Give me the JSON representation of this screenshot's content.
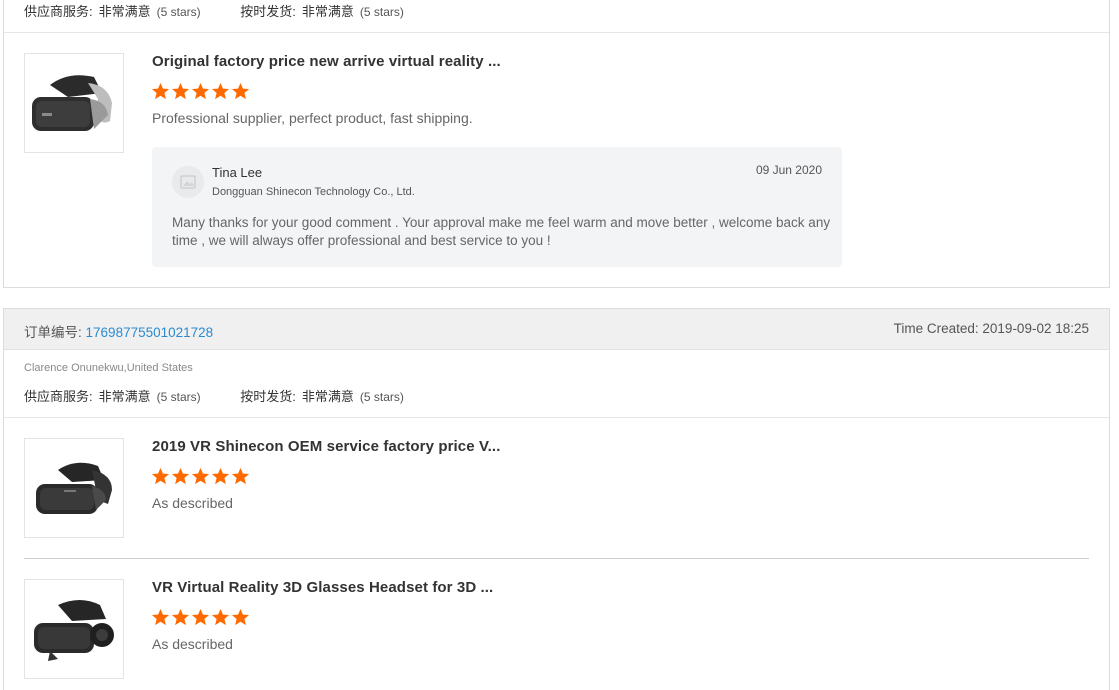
{
  "colors": {
    "star": "#ff6a00",
    "link": "#2a8bd1"
  },
  "card1": {
    "ratings": {
      "service_label": "供应商服务:",
      "service_value": "非常满意",
      "service_stars": "(5 stars)",
      "delivery_label": "按时发货:",
      "delivery_value": "非常满意",
      "delivery_stars": "(5 stars)"
    },
    "item": {
      "title": "Original factory price new arrive virtual reality ...",
      "rating": 5,
      "comment": "Professional supplier, perfect product, fast shipping.",
      "image_icon": "vr-headset-icon"
    },
    "reply": {
      "name": "Tina Lee",
      "company": "Dongguan Shinecon Technology Co., Ltd.",
      "date": "09 Jun 2020",
      "message": "Many thanks for your good comment . Your approval make me feel warm and move better , welcome back any time , we will always offer professional and best service to you !",
      "avatar_icon": "avatar-placeholder-icon"
    }
  },
  "card2": {
    "order_label": "订单编号:",
    "order_number": "17698775501021728",
    "time_created_label": "Time Created:",
    "time_created_value": "2019-09-02 18:25",
    "buyer": "Clarence Onunekwu,United States",
    "ratings": {
      "service_label": "供应商服务:",
      "service_value": "非常满意",
      "service_stars": "(5 stars)",
      "delivery_label": "按时发货:",
      "delivery_value": "非常满意",
      "delivery_stars": "(5 stars)"
    },
    "items": [
      {
        "title": "2019 VR Shinecon OEM service factory price V...",
        "rating": 5,
        "comment": "As described",
        "image_icon": "vr-headset-icon"
      },
      {
        "title": "VR Virtual Reality 3D Glasses Headset for 3D ...",
        "rating": 5,
        "comment": "As described",
        "image_icon": "vr-headset-headphones-icon"
      }
    ]
  }
}
